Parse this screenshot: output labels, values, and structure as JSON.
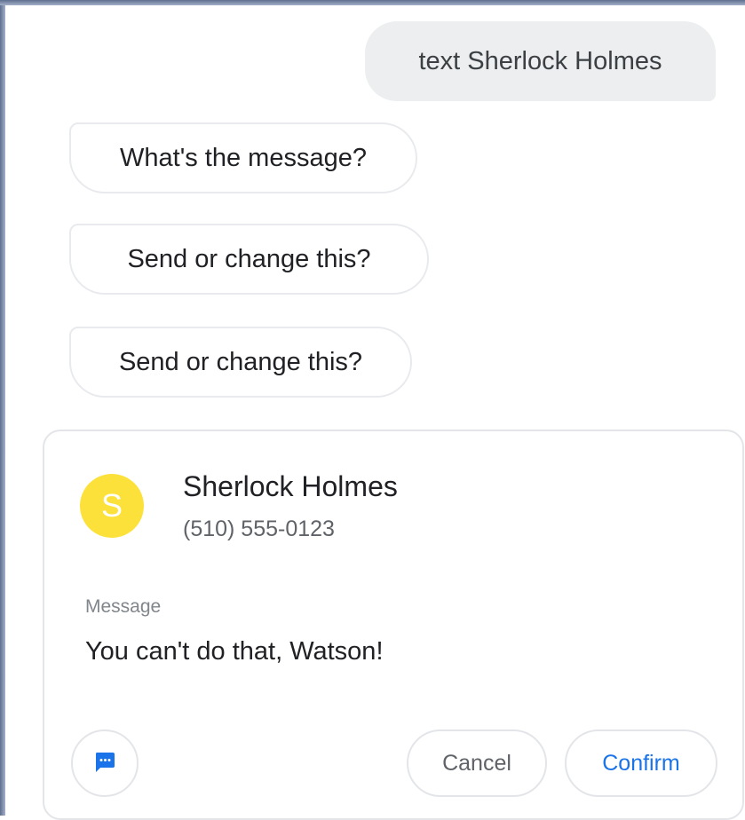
{
  "conversation": {
    "user_query": "text Sherlock Holmes",
    "assistant_replies": [
      "What's the message?",
      "Send or change this?",
      "Send or change this?"
    ]
  },
  "contact_card": {
    "avatar_initial": "S",
    "name": "Sherlock Holmes",
    "phone": "(510) 555-0123",
    "message_label": "Message",
    "message_text": "You can't do that, Watson!",
    "app_icon": "messages-icon",
    "cancel_label": "Cancel",
    "confirm_label": "Confirm"
  },
  "colors": {
    "avatar": "#fde13b",
    "user_bubble": "#eceef0",
    "confirm_accent": "#1a73e8",
    "messages_icon": "#1a73e8"
  }
}
